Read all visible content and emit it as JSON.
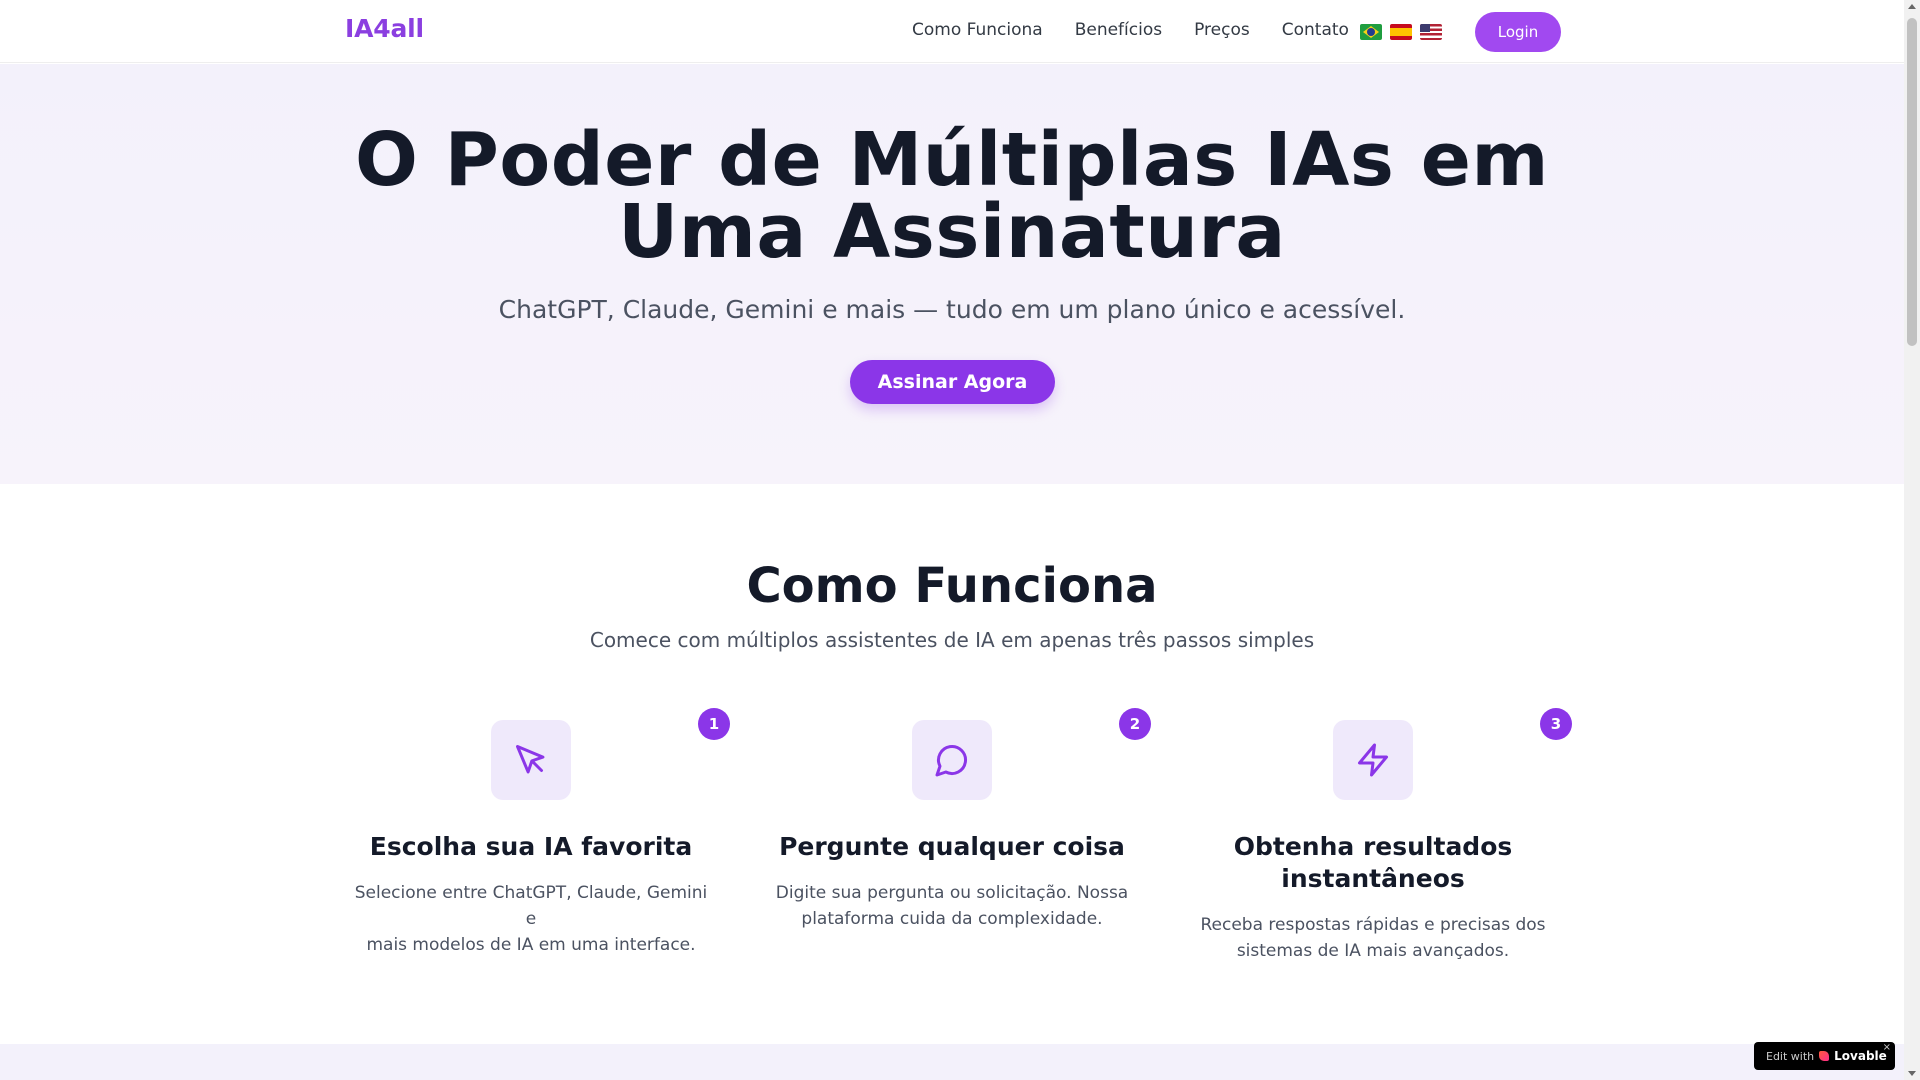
{
  "header": {
    "logo": "IA4all",
    "nav": [
      "Como Funciona",
      "Benefícios",
      "Preços",
      "Contato"
    ],
    "flags": [
      "brazil-flag-icon",
      "spain-flag-icon",
      "usa-flag-icon"
    ],
    "login_label": "Login"
  },
  "hero": {
    "title_line1": "O Poder de Múltiplas IAs em",
    "title_line2": "Uma Assinatura",
    "subtitle": "ChatGPT, Claude, Gemini e mais — tudo em um plano único e acessível.",
    "cta_label": "Assinar Agora"
  },
  "how": {
    "title": "Como Funciona",
    "subtitle": "Comece com múltiplos assistentes de IA em apenas três passos simples",
    "steps": [
      {
        "number": "1",
        "icon": "cursor-pointer-icon",
        "title": "Escolha sua IA favorita",
        "desc_line1": "Selecione entre ChatGPT, Claude, Gemini e",
        "desc_line2": "mais modelos de IA em uma interface."
      },
      {
        "number": "2",
        "icon": "chat-bubble-icon",
        "title": "Pergunte qualquer coisa",
        "desc_line1": "Digite sua pergunta ou solicitação. Nossa",
        "desc_line2": "plataforma cuida da complexidade."
      },
      {
        "number": "3",
        "icon": "lightning-bolt-icon",
        "title_line1": "Obtenha resultados",
        "title_line2": "instantâneos",
        "desc_line1": "Receba respostas rápidas e precisas dos",
        "desc_line2": "sistemas de IA mais avançados."
      }
    ]
  },
  "badge": {
    "edit_label": "Edit with",
    "brand": "Lovable",
    "close": "×"
  },
  "colors": {
    "accent": "#8b36e8",
    "logo": "#8b3fe0",
    "login": "#a149f0",
    "hero_bg": "#f3f1fb",
    "icon_box": "#efe9fb"
  }
}
